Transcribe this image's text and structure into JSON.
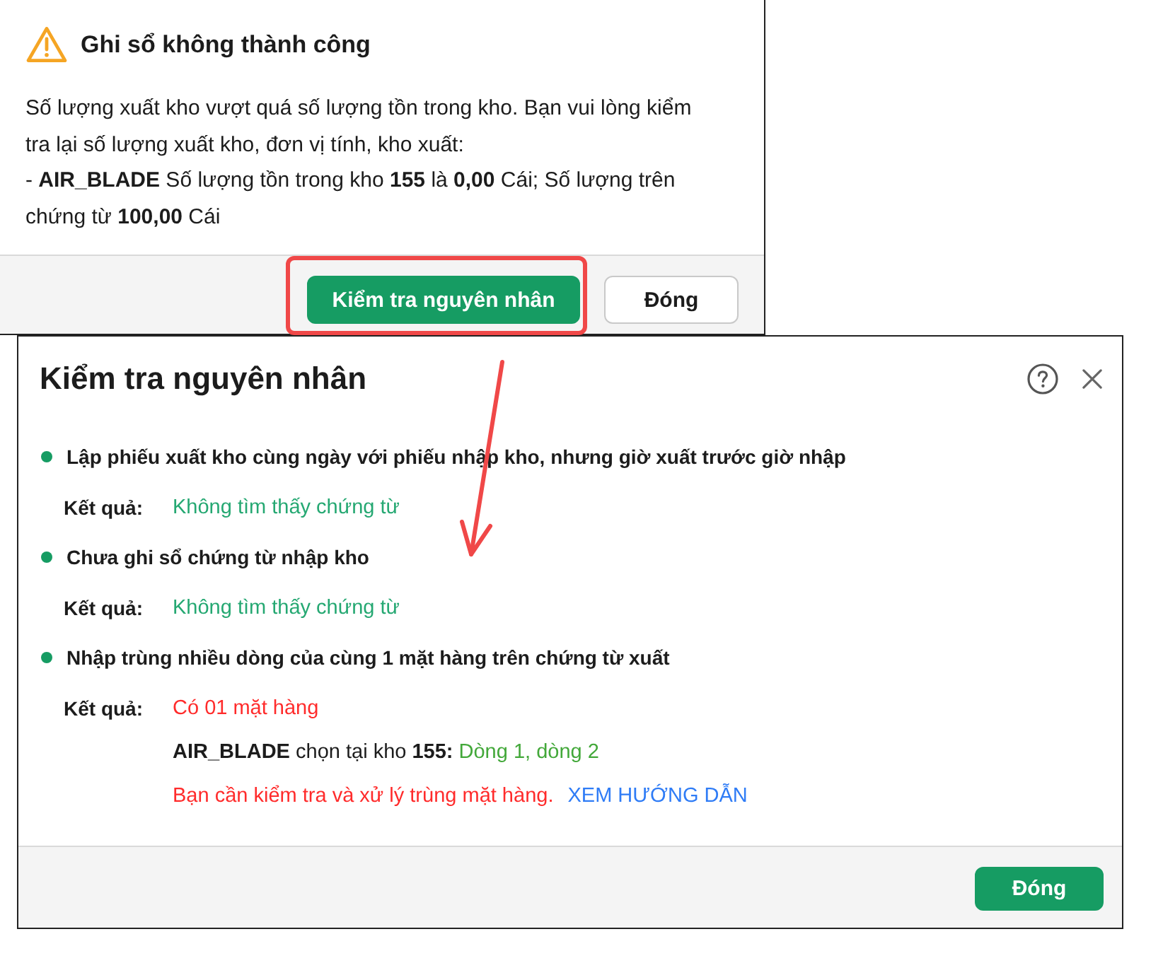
{
  "error_dialog": {
    "title": "Ghi sổ không thành công",
    "message": "Số lượng xuất kho vượt quá số lượng tồn trong kho. Bạn vui lòng kiểm tra lại số lượng xuất kho, đơn vị tính, kho xuất:",
    "detail": "- **AIR_BLADE** Số lượng tồn trong kho **155** là **0,00** Cái; Số lượng trên chứng từ **100,00** Cái",
    "buttons": [
      {
        "label": "Kiểm tra nguyên nhân",
        "kind": "primary",
        "highlighted": true
      },
      {
        "label": "Đóng",
        "kind": "secondary",
        "highlighted": false
      }
    ]
  },
  "cause_dialog": {
    "title": "Kiểm tra nguyên nhân",
    "checks": [
      {
        "title": "Lập phiếu xuất kho cùng ngày với phiếu nhập kho, nhưng giờ xuất trước giờ nhập",
        "result": {
          "label": "Kết quả:",
          "text": "Không tìm thấy chứng từ",
          "color": "#25a872"
        }
      },
      {
        "title": "Chưa ghi sổ chứng từ nhập kho",
        "result": {
          "label": "Kết quả:",
          "text": "Không tìm thấy chứng từ",
          "color": "#25a872"
        }
      },
      {
        "title": "Nhập trùng nhiều dòng của cùng 1 mặt hàng trên chứng từ xuất",
        "result": {
          "label": "Kết quả:",
          "text": "Có 01 mặt hàng",
          "color": "#ff2b2b"
        },
        "detail": {
          "text": "**AIR_BLADE** chọn tại kho **155:**",
          "rows": "Dòng 1, dòng 2"
        },
        "note": {
          "text": "Bạn cần kiểm tra và xử lý trùng mặt hàng.",
          "link": "XEM HƯỚNG DẪN"
        }
      }
    ],
    "buttons": [
      {
        "label": "Đóng",
        "kind": "primary"
      }
    ]
  }
}
